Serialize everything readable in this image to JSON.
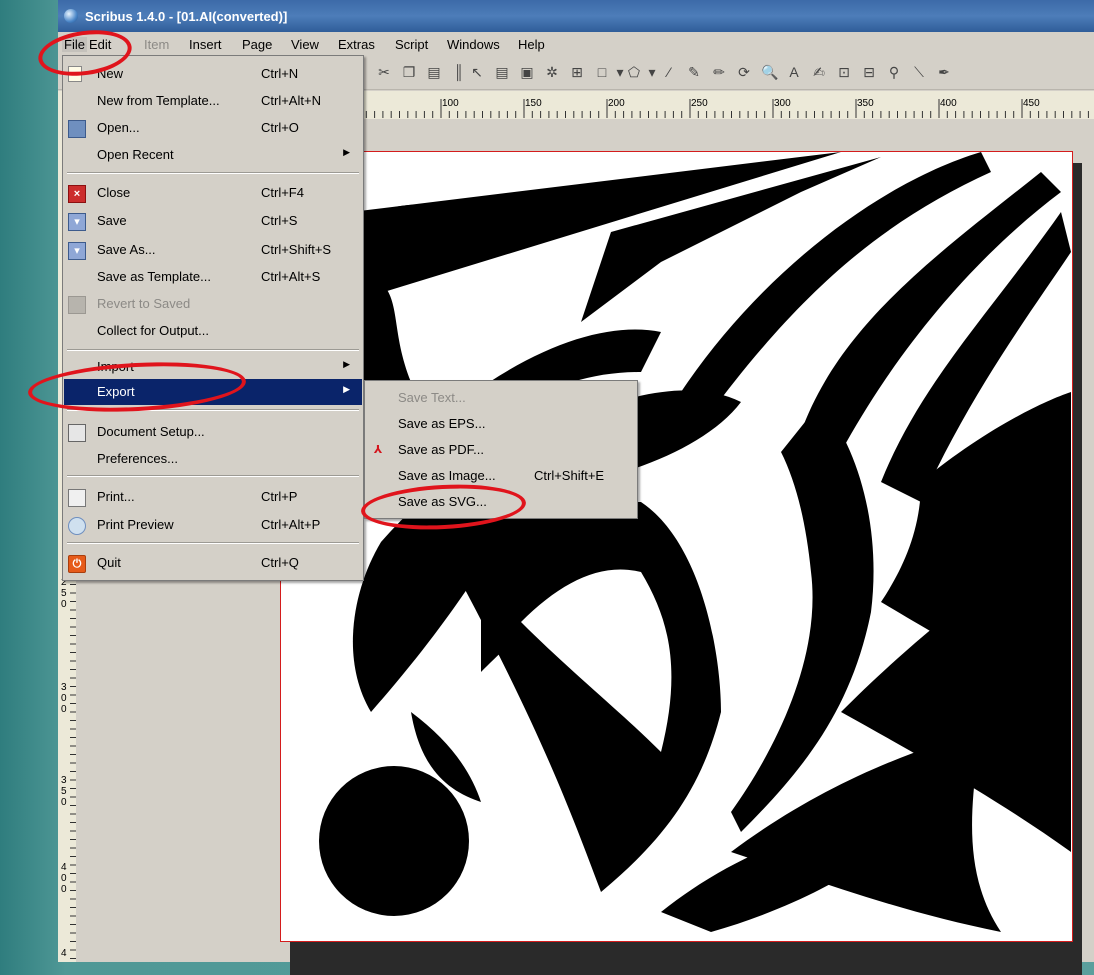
{
  "window": {
    "title": "Scribus 1.4.0 - [01.AI(converted)]"
  },
  "menubar": {
    "items": [
      {
        "label": "File",
        "state": "open"
      },
      {
        "label": "Edit",
        "state": "normal"
      },
      {
        "label": "Item",
        "state": "disabled"
      },
      {
        "label": "Insert",
        "state": "normal"
      },
      {
        "label": "Page",
        "state": "normal"
      },
      {
        "label": "View",
        "state": "normal"
      },
      {
        "label": "Extras",
        "state": "normal"
      },
      {
        "label": "Script",
        "state": "normal"
      },
      {
        "label": "Windows",
        "state": "normal"
      },
      {
        "label": "Help",
        "state": "normal"
      }
    ]
  },
  "file_menu": {
    "items": [
      {
        "label": "New",
        "shortcut": "Ctrl+N",
        "icon": "new-document-icon"
      },
      {
        "label": "New from Template...",
        "shortcut": "Ctrl+Alt+N"
      },
      {
        "label": "Open...",
        "shortcut": "Ctrl+O",
        "icon": "open-folder-icon"
      },
      {
        "label": "Open Recent",
        "submenu": true
      },
      {
        "label": "Close",
        "shortcut": "Ctrl+F4",
        "icon": "close-icon"
      },
      {
        "label": "Save",
        "shortcut": "Ctrl+S",
        "icon": "save-icon"
      },
      {
        "label": "Save As...",
        "shortcut": "Ctrl+Shift+S",
        "icon": "save-as-icon"
      },
      {
        "label": "Save as Template...",
        "shortcut": "Ctrl+Alt+S"
      },
      {
        "label": "Revert to Saved",
        "disabled": true,
        "icon": "revert-icon"
      },
      {
        "label": "Collect for Output..."
      },
      {
        "label": "Import",
        "submenu": true
      },
      {
        "label": "Export",
        "submenu": true,
        "highlighted": true
      },
      {
        "label": "Document Setup...",
        "icon": "document-setup-icon"
      },
      {
        "label": "Preferences..."
      },
      {
        "label": "Print...",
        "shortcut": "Ctrl+P",
        "icon": "printer-icon"
      },
      {
        "label": "Print Preview",
        "shortcut": "Ctrl+Alt+P",
        "icon": "print-preview-icon"
      },
      {
        "label": "Quit",
        "shortcut": "Ctrl+Q",
        "icon": "quit-icon"
      }
    ]
  },
  "export_menu": {
    "items": [
      {
        "label": "Save Text...",
        "disabled": true
      },
      {
        "label": "Save as EPS..."
      },
      {
        "label": "Save as PDF...",
        "icon": "pdf-icon"
      },
      {
        "label": "Save as Image...",
        "shortcut": "Ctrl+Shift+E"
      },
      {
        "label": "Save as SVG..."
      }
    ]
  },
  "ruler": {
    "horizontal_labels": [
      "100",
      "150",
      "200",
      "250",
      "300",
      "350",
      "400",
      "450"
    ],
    "vertical_labels": [
      "250",
      "300",
      "350",
      "400",
      "4"
    ]
  },
  "annotation_color": "#e0141c",
  "selection_color": "#0a246a"
}
